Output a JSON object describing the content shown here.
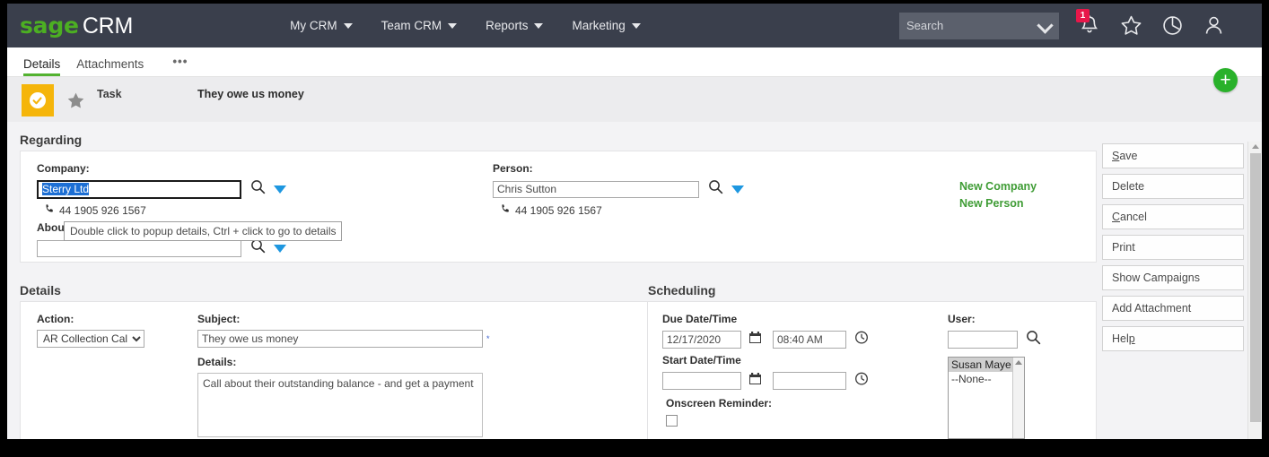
{
  "header": {
    "logo_sage": "sage",
    "logo_crm": "CRM",
    "nav": [
      {
        "label": "My CRM",
        "icon": "chevron-down-icon"
      },
      {
        "label": "Team CRM",
        "icon": "chevron-down-icon"
      },
      {
        "label": "Reports",
        "icon": "chevron-down-icon"
      },
      {
        "label": "Marketing",
        "icon": "chevron-down-icon"
      }
    ],
    "search": {
      "placeholder": "Search",
      "value": "",
      "icon": "chevron-down-icon"
    },
    "icons": [
      {
        "name": "notification-bell-icon",
        "badge": "1"
      },
      {
        "name": "favorite-star-icon",
        "badge": ""
      },
      {
        "name": "recent-history-icon",
        "badge": ""
      },
      {
        "name": "user-profile-icon",
        "badge": ""
      }
    ],
    "colors": {
      "bar": "#3a3f4c",
      "brand_green": "#4caf22",
      "badge_red": "#e8174a"
    }
  },
  "tabs": [
    {
      "label": "Details",
      "active": true
    },
    {
      "label": "Attachments",
      "active": false
    },
    {
      "label": "•••",
      "active": false
    }
  ],
  "record": {
    "status_icon": "check-circle-icon",
    "status_color": "#f5b50a",
    "favorite_icon": "star-icon",
    "type_label": "Task",
    "title": "They owe us money",
    "add_button_label": "+"
  },
  "regarding": {
    "section_title": "Regarding",
    "company": {
      "label": "Company:",
      "value": "Sterry Ltd",
      "selected": true,
      "phone": "44 1905 926 1567",
      "search_icon": "magnifier-icon",
      "dropdown_icon": "caret-down-icon"
    },
    "person": {
      "label": "Person:",
      "value": "Chris Sutton",
      "phone": "44 1905 926 1567",
      "search_icon": "magnifier-icon",
      "dropdown_icon": "caret-down-icon"
    },
    "about": {
      "label": "About:",
      "value": "",
      "search_icon": "magnifier-icon",
      "dropdown_icon": "caret-down-icon"
    },
    "links": [
      {
        "label": "New Company"
      },
      {
        "label": "New Person"
      }
    ],
    "tooltip": "Double click to popup details, Ctrl + click to go to details"
  },
  "details": {
    "section_title": "Details",
    "action": {
      "label": "Action:",
      "value": "AR Collection Call",
      "options": [
        "AR Collection Call"
      ]
    },
    "subject": {
      "label": "Subject:",
      "value": "They owe us money",
      "required_marker": "*"
    },
    "notes": {
      "label": "Details:",
      "value": "Call about their outstanding balance - and get a payment"
    }
  },
  "scheduling": {
    "section_title": "Scheduling",
    "due": {
      "label": "Due Date/Time",
      "date": "12/17/2020",
      "time": "08:40 AM",
      "calendar_icon": "calendar-icon",
      "clock_icon": "clock-icon"
    },
    "start": {
      "label": "Start Date/Time",
      "date": "",
      "time": "",
      "calendar_icon": "calendar-icon",
      "clock_icon": "clock-icon"
    },
    "reminder": {
      "label": "Onscreen Reminder:",
      "checked": false
    },
    "user": {
      "label": "User:",
      "value": "",
      "search_icon": "magnifier-icon",
      "options": [
        {
          "label": "Susan Maye",
          "selected": true
        },
        {
          "label": "--None--",
          "selected": false
        }
      ]
    }
  },
  "actions": [
    {
      "label": "Save",
      "accesskey": "S"
    },
    {
      "label": "Delete",
      "accesskey": ""
    },
    {
      "label": "Cancel",
      "accesskey": "C"
    },
    {
      "label": "Print",
      "accesskey": ""
    },
    {
      "label": "Show Campaigns",
      "accesskey": ""
    },
    {
      "label": "Add Attachment",
      "accesskey": ""
    },
    {
      "label": "Help",
      "accesskey": "p"
    }
  ]
}
